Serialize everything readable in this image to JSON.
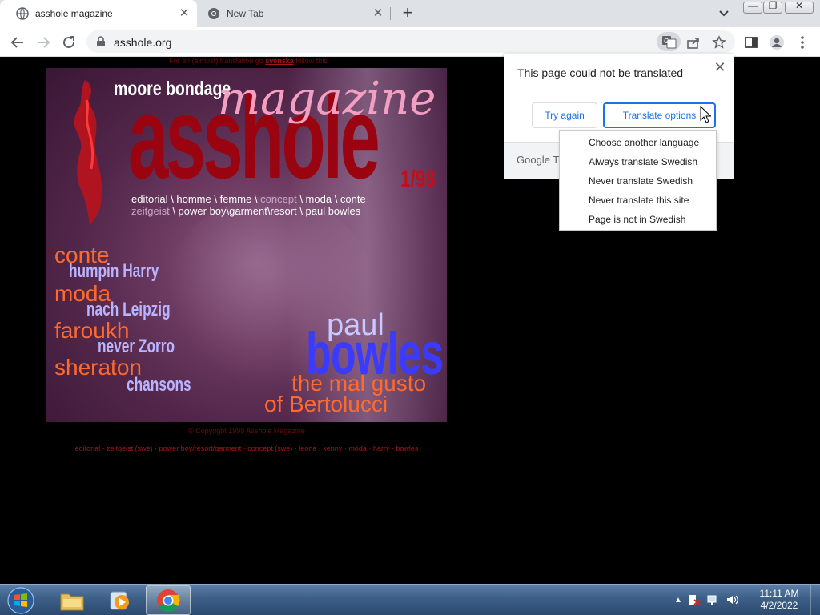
{
  "browser": {
    "tabs": [
      {
        "title": "asshole magazine",
        "active": true
      },
      {
        "title": "New Tab",
        "active": false
      }
    ],
    "url": "asshole.org"
  },
  "page": {
    "top_note": "For an (almost) translation go",
    "top_link": "svenska",
    "top_note_end": "follow this",
    "masthead": {
      "moore": "moore bondage",
      "name": "asshole",
      "magazine": "magazine",
      "issue": "1/98"
    },
    "nav_line1": [
      "editorial",
      "homme",
      "femme",
      "concept",
      "moda",
      "conte"
    ],
    "nav_line2": [
      "zeitgeist",
      "power boy\\garment\\resort",
      "paul bowles"
    ],
    "features": [
      {
        "title": "conte",
        "sub": "humpin Harry"
      },
      {
        "title": "moda",
        "sub": "nach Leipzig"
      },
      {
        "title": "faroukh",
        "sub": "never Zorro"
      },
      {
        "title": "sheraton",
        "sub": "chansons"
      }
    ],
    "cover_story": {
      "first": "paul",
      "last": "bowles",
      "line1": "the mal gusto",
      "line2": "of Bertolucci"
    },
    "copyright": "© Copyright 1998 Asshole Magazine",
    "bottom_links": [
      "editorial",
      "zeitgeist (swe)",
      "power boy/resort/garment",
      "concept (swe)",
      "leona",
      "kenny",
      "moda",
      "harry",
      "bowles"
    ]
  },
  "translate": {
    "message": "This page could not be translated",
    "try_again": "Try again",
    "options": "Translate options",
    "footer": "Google Tr",
    "menu": [
      "Choose another language",
      "Always translate Swedish",
      "Never translate Swedish",
      "Never translate this site",
      "Page is not in Swedish"
    ]
  },
  "taskbar": {
    "time": "11:11 AM",
    "date": "4/2/2022"
  },
  "colors": {
    "accent": "#1a73e8",
    "masthead_red": "#9a0410",
    "feature_orange": "#ff6a2c",
    "bowles_blue": "#3b3bff"
  }
}
